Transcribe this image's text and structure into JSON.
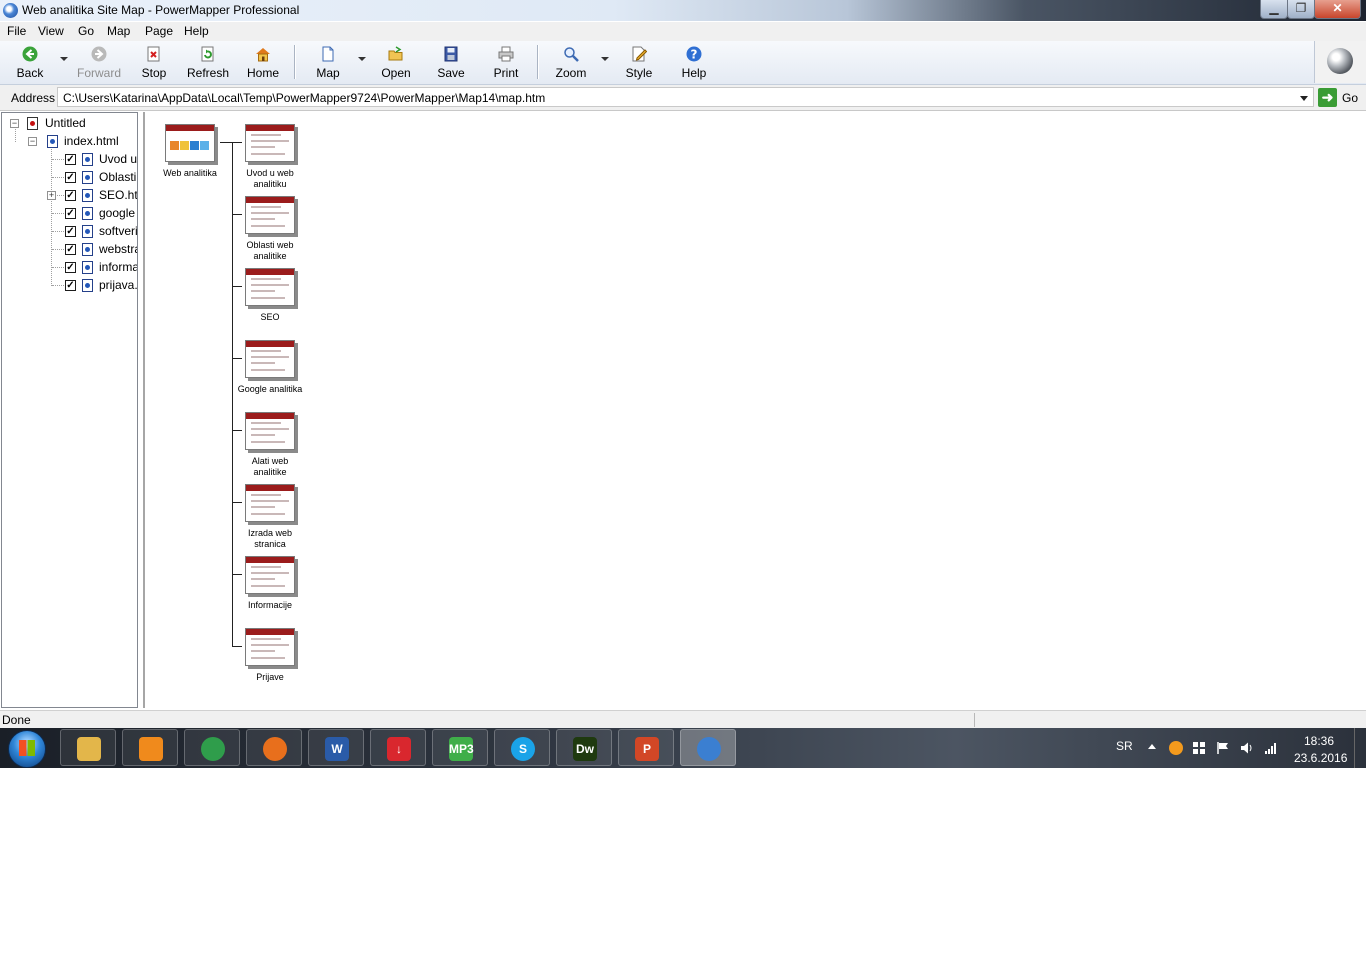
{
  "window": {
    "title": "Web analitika Site Map - PowerMapper Professional"
  },
  "menu": [
    "File",
    "View",
    "Go",
    "Map",
    "Page",
    "Help"
  ],
  "toolbar": {
    "back": "Back",
    "forward": "Forward",
    "stop": "Stop",
    "refresh": "Refresh",
    "home": "Home",
    "map": "Map",
    "open": "Open",
    "save": "Save",
    "print": "Print",
    "zoom": "Zoom",
    "style": "Style",
    "help": "Help"
  },
  "address": {
    "label": "Address",
    "value": "C:\\Users\\Katarina\\AppData\\Local\\Temp\\PowerMapper9724\\PowerMapper\\Map14\\map.htm",
    "go": "Go"
  },
  "tree": {
    "root": "Untitled",
    "index": "index.html",
    "items": [
      "Uvod u",
      "Oblasti",
      "SEO.htr",
      "google",
      "softveri",
      "webstra",
      "informa",
      "prijava."
    ]
  },
  "map": {
    "root": "Web analitika",
    "nodes": [
      {
        "caption": "Uvod u web analitiku"
      },
      {
        "caption": "Oblasti web analitike"
      },
      {
        "caption": "SEO"
      },
      {
        "caption": "Google analitika"
      },
      {
        "caption": "Alati web analitike"
      },
      {
        "caption": "Izrada web stranica"
      },
      {
        "caption": "Informacije"
      },
      {
        "caption": "Prijave"
      }
    ]
  },
  "status": {
    "text": "Done"
  },
  "taskbar": {
    "apps": [
      {
        "icon": "explorer-icon",
        "label": "",
        "color": "#e3b64a"
      },
      {
        "icon": "media-player-icon",
        "label": "",
        "color": "#f08a1c"
      },
      {
        "icon": "chrome-icon",
        "label": "",
        "color": "#2f9d4b"
      },
      {
        "icon": "firefox-icon",
        "label": "",
        "color": "#e86f1c"
      },
      {
        "icon": "word-icon",
        "label": "W",
        "color": "#2a5ba8"
      },
      {
        "icon": "download-icon",
        "label": "↓",
        "color": "#d9272e"
      },
      {
        "icon": "mp3-icon",
        "label": "MP3",
        "color": "#3fae49"
      },
      {
        "icon": "skype-icon",
        "label": "S",
        "color": "#1aa3e8"
      },
      {
        "icon": "dreamweaver-icon",
        "label": "Dw",
        "color": "#1f3a0f"
      },
      {
        "icon": "powerpoint-icon",
        "label": "P",
        "color": "#d24726"
      },
      {
        "icon": "powermapper-icon",
        "label": "",
        "color": "#3b7fd1"
      }
    ],
    "lang": "SR",
    "time": "18:36",
    "date": "23.6.2016"
  }
}
